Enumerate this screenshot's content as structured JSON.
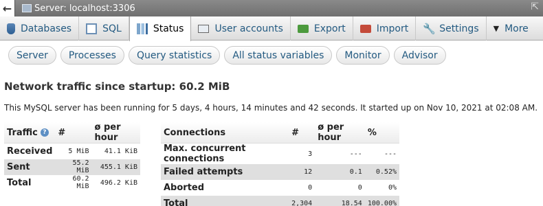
{
  "window": {
    "title": "Server: localhost:3306"
  },
  "tabs": [
    {
      "label": "Databases",
      "icon": "database-icon"
    },
    {
      "label": "SQL",
      "icon": "sql-icon"
    },
    {
      "label": "Status",
      "icon": "status-icon",
      "active": true
    },
    {
      "label": "User accounts",
      "icon": "users-icon"
    },
    {
      "label": "Export",
      "icon": "export-icon"
    },
    {
      "label": "Import",
      "icon": "import-icon"
    },
    {
      "label": "Settings",
      "icon": "wrench-icon"
    },
    {
      "label": "More",
      "icon": "chevron-down-icon"
    }
  ],
  "subtabs": [
    "Server",
    "Processes",
    "Query statistics",
    "All status variables",
    "Monitor",
    "Advisor"
  ],
  "heading": "Network traffic since startup: 60.2 MiB",
  "info": "This MySQL server has been running for 5 days, 4 hours, 14 minutes and 42 seconds. It started up on Nov 10, 2021 at 02:08 AM.",
  "traffic": {
    "headers": [
      "Traffic",
      "#",
      "ø per hour"
    ],
    "rows": [
      [
        "Received",
        "5 MiB",
        "41.1 KiB"
      ],
      [
        "Sent",
        "55.2 MiB",
        "455.1 KiB"
      ],
      [
        "Total",
        "60.2 MiB",
        "496.2 KiB"
      ]
    ]
  },
  "connections": {
    "headers": [
      "Connections",
      "#",
      "ø per hour",
      "%"
    ],
    "rows": [
      [
        "Max. concurrent connections",
        "3",
        "---",
        "---"
      ],
      [
        "Failed attempts",
        "12",
        "0.1",
        "0.52%"
      ],
      [
        "Aborted",
        "0",
        "0",
        "0%"
      ],
      [
        "Total",
        "2,304",
        "18.54",
        "100.00%"
      ]
    ]
  },
  "colors": {
    "link": "#235a81",
    "row_alt": "#dfdfdf"
  }
}
